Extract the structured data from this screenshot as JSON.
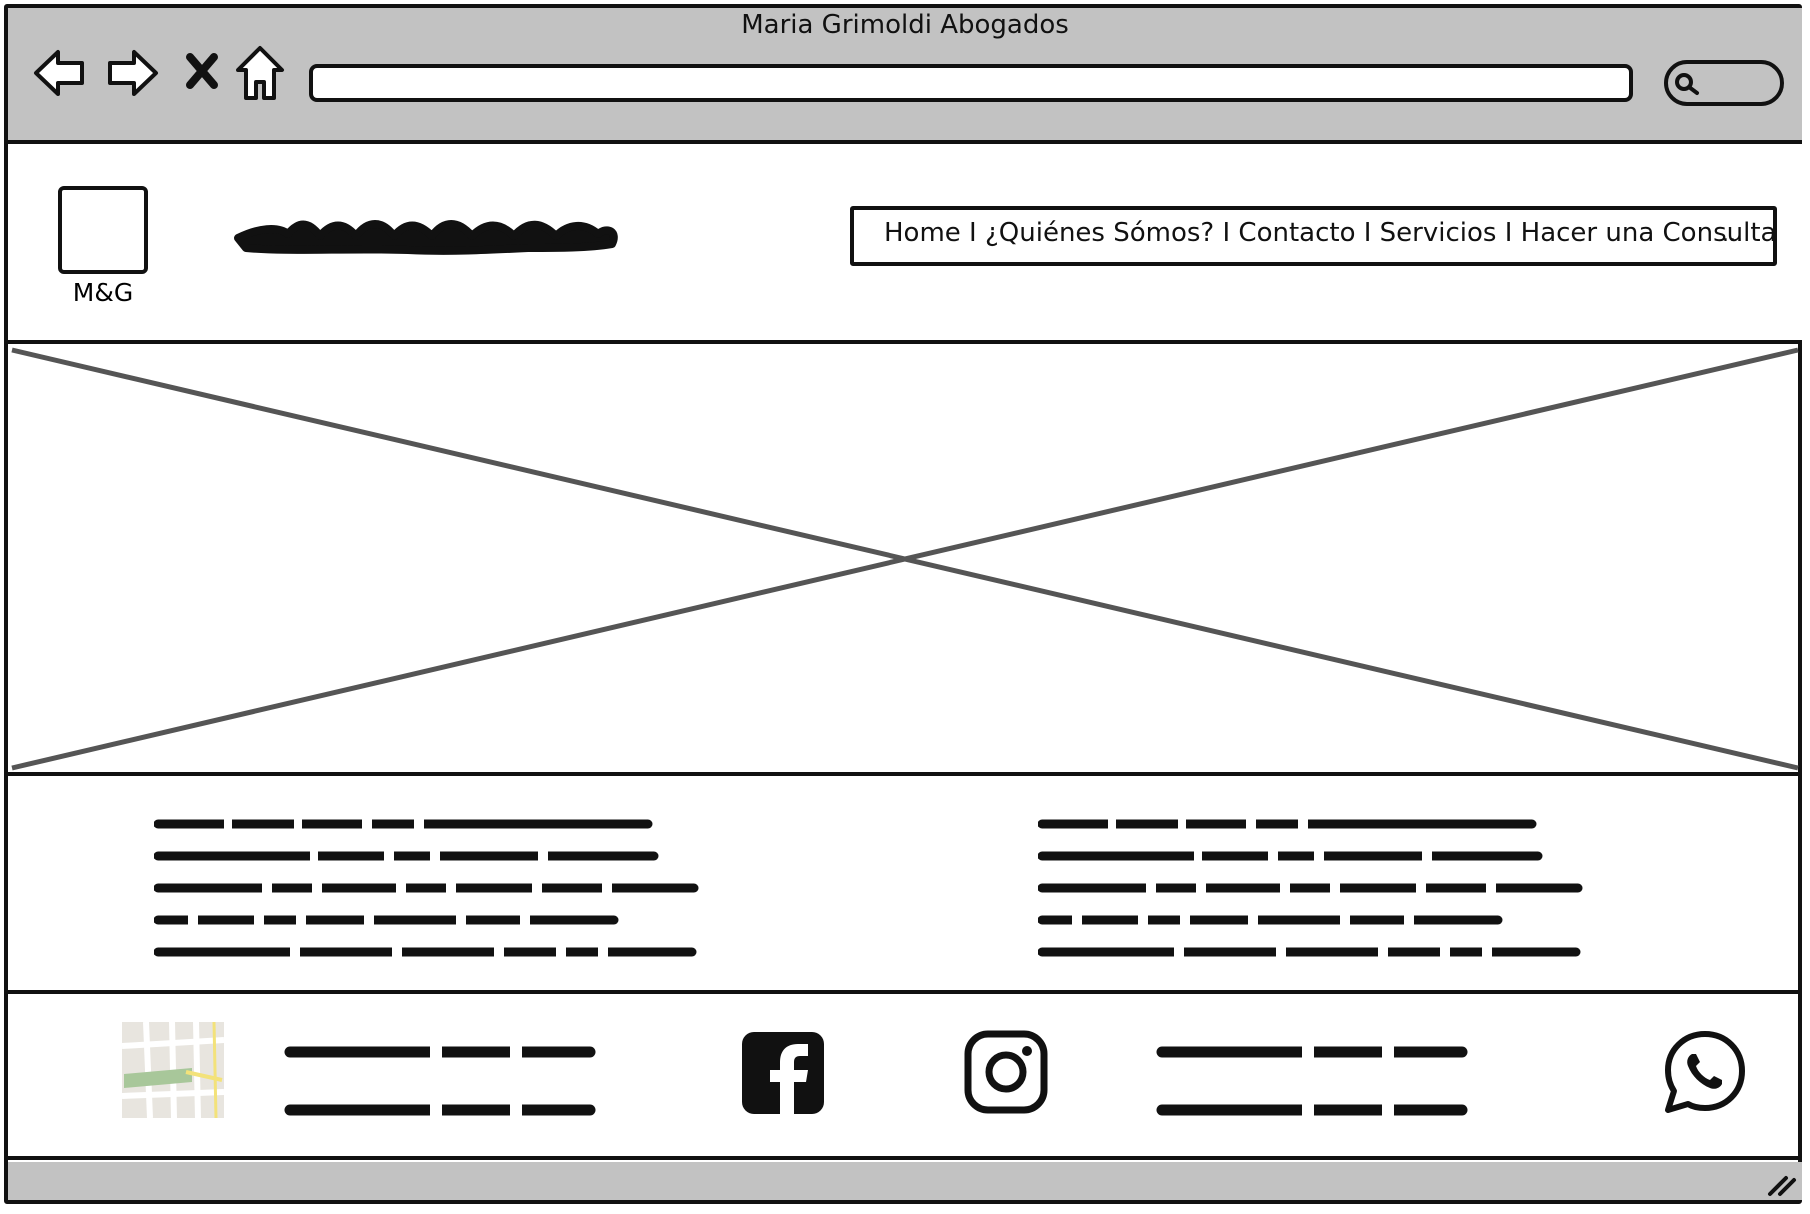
{
  "window": {
    "title": "Maria Grimoldi Abogados"
  },
  "toolbar": {
    "icons": [
      "back-arrow-icon",
      "forward-arrow-icon",
      "close-x-icon",
      "home-icon",
      "search-icon"
    ],
    "url_value": "",
    "search_value": ""
  },
  "header": {
    "logo_text": "M&G",
    "site_name_placeholder": "scribble-text",
    "nav_menu_text": "Home I ¿Quiénes Sómos? I Contacto I Servicios I Hacer una Consulta",
    "nav_more": "..."
  },
  "hero": {
    "image_placeholder": "image-placeholder-x"
  },
  "content": {
    "columns": [
      "scribble-paragraph",
      "scribble-paragraph"
    ]
  },
  "footer": {
    "icons": [
      "map-icon",
      "facebook-icon",
      "instagram-icon",
      "whatsapp-icon"
    ],
    "text_blocks": [
      "scribble-text",
      "scribble-text"
    ]
  },
  "colors": {
    "chrome_gray": "#c2c2c2",
    "ink": "#111111",
    "placeholder_line": "#555555",
    "map_green": "#a8c79a",
    "map_yellow": "#f3e27a"
  }
}
